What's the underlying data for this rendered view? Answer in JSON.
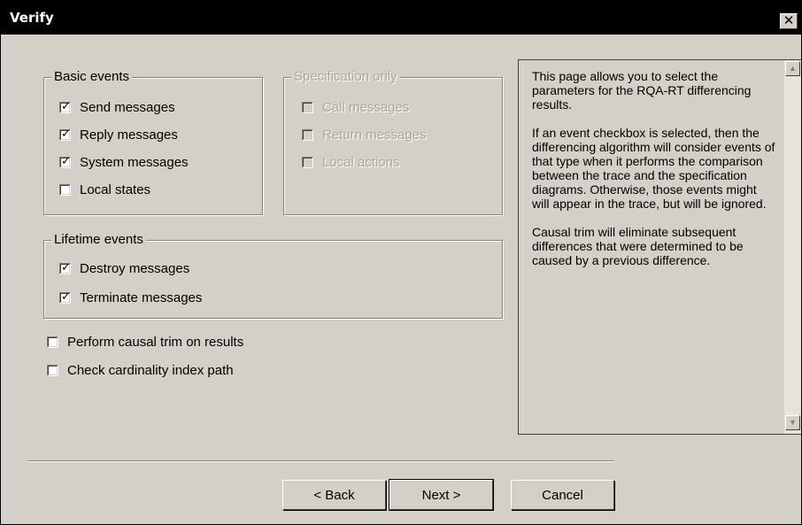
{
  "window": {
    "title": "Verify",
    "close_glyph": "✕"
  },
  "basic_events": {
    "label": "Basic events",
    "items": [
      {
        "label": "Send messages",
        "checked": true
      },
      {
        "label": "Reply messages",
        "checked": true
      },
      {
        "label": "System messages",
        "checked": true
      },
      {
        "label": "Local states",
        "checked": false
      }
    ]
  },
  "specification_only": {
    "label": "Specification only",
    "items": [
      {
        "label": "Call messages",
        "checked": false,
        "disabled": true
      },
      {
        "label": "Return messages",
        "checked": false,
        "disabled": true
      },
      {
        "label": "Local actions",
        "checked": false,
        "disabled": true
      }
    ]
  },
  "lifetime_events": {
    "label": "Lifetime events",
    "items": [
      {
        "label": "Destroy messages",
        "checked": true
      },
      {
        "label": "Terminate messages",
        "checked": true
      }
    ]
  },
  "options": [
    {
      "label": "Perform causal trim on results",
      "checked": false
    },
    {
      "label": "Check cardinality index path",
      "checked": false
    }
  ],
  "help": {
    "paragraphs": [
      "This page allows you to select the parameters for the RQA-RT differencing results.",
      "If an event checkbox is selected, then the differencing algorithm will consider events of that type when it performs the comparison between the trace and the specification diagrams.  Otherwise, those events might will appear in the trace, but will be ignored.",
      "Causal trim will eliminate subsequent differences that were determined to be caused by a previous difference."
    ],
    "scroll_up_icon": "▲",
    "scroll_down_icon": "▼"
  },
  "buttons": {
    "back": "< Back",
    "next": "Next >",
    "cancel": "Cancel"
  },
  "check_glyph": "✓"
}
